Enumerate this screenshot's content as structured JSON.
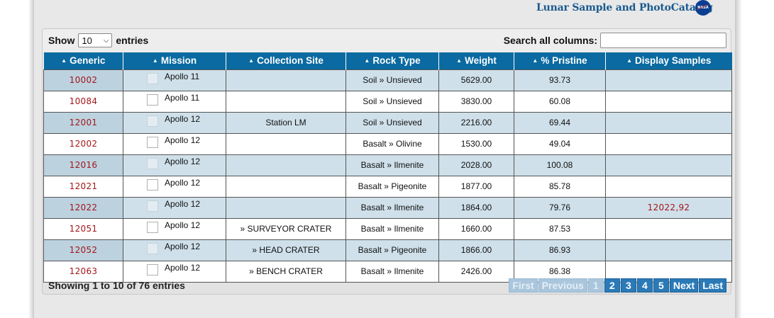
{
  "header": {
    "site_title": "Lunar Sample and PhotoCatalog",
    "logo_text": "NASA"
  },
  "controls": {
    "show_label": "Show",
    "entries_per_page": "10",
    "entries_label": "entries",
    "search_label": "Search all columns:",
    "search_value": ""
  },
  "table": {
    "columns": [
      "Generic",
      "Mission",
      "Collection Site",
      "Rock Type",
      "Weight",
      "% Pristine",
      "Display Samples"
    ],
    "rows": [
      {
        "generic": "10002",
        "mission": "Apollo 11",
        "site": "",
        "rock": "Soil » Unsieved",
        "weight": "5629.00",
        "pristine": "93.73",
        "display": ""
      },
      {
        "generic": "10084",
        "mission": "Apollo 11",
        "site": "",
        "rock": "Soil » Unsieved",
        "weight": "3830.00",
        "pristine": "60.08",
        "display": ""
      },
      {
        "generic": "12001",
        "mission": "Apollo 12",
        "site": "Station LM",
        "rock": "Soil » Unsieved",
        "weight": "2216.00",
        "pristine": "69.44",
        "display": ""
      },
      {
        "generic": "12002",
        "mission": "Apollo 12",
        "site": "",
        "rock": "Basalt » Olivine",
        "weight": "1530.00",
        "pristine": "49.04",
        "display": ""
      },
      {
        "generic": "12016",
        "mission": "Apollo 12",
        "site": "",
        "rock": "Basalt » Ilmenite",
        "weight": "2028.00",
        "pristine": "100.08",
        "display": ""
      },
      {
        "generic": "12021",
        "mission": "Apollo 12",
        "site": "",
        "rock": "Basalt » Pigeonite",
        "weight": "1877.00",
        "pristine": "85.78",
        "display": ""
      },
      {
        "generic": "12022",
        "mission": "Apollo 12",
        "site": "",
        "rock": "Basalt » Ilmenite",
        "weight": "1864.00",
        "pristine": "79.76",
        "display": "12022,92"
      },
      {
        "generic": "12051",
        "mission": "Apollo 12",
        "site": "» SURVEYOR CRATER",
        "rock": "Basalt » Ilmenite",
        "weight": "1660.00",
        "pristine": "87.53",
        "display": ""
      },
      {
        "generic": "12052",
        "mission": "Apollo 12",
        "site": "» HEAD CRATER",
        "rock": "Basalt » Pigeonite",
        "weight": "1866.00",
        "pristine": "86.93",
        "display": ""
      },
      {
        "generic": "12063",
        "mission": "Apollo 12",
        "site": "» BENCH CRATER",
        "rock": "Basalt » Ilmenite",
        "weight": "2426.00",
        "pristine": "86.38",
        "display": ""
      }
    ]
  },
  "footer": {
    "info": "Showing 1 to 10 of 76 entries",
    "pagination": {
      "first": "First",
      "previous": "Previous",
      "pages": [
        "1",
        "2",
        "3",
        "4",
        "5"
      ],
      "current_page": "1",
      "next": "Next",
      "last": "Last"
    }
  },
  "colors": {
    "header_bg": "#0a6aa1",
    "link_red": "#a3161a",
    "row_odd": "#cfe0ea",
    "title_blue": "#1a5a8e"
  }
}
